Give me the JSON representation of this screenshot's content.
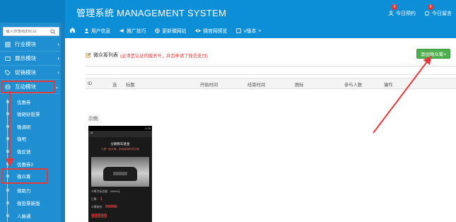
{
  "header": {
    "title": "管理系统 MANAGEMENT SYSTEM",
    "links": [
      {
        "label": "今日预约",
        "badge": "0",
        "icon": "user-icon"
      },
      {
        "label": "今日留言",
        "badge": "0",
        "icon": "message-icon"
      }
    ]
  },
  "sidebar": {
    "search_placeholder": "输入你想找的栏目",
    "sections": [
      {
        "label": "行业模块",
        "icon": "grid-icon"
      },
      {
        "label": "展示模块",
        "icon": "display-icon"
      },
      {
        "label": "促销模块",
        "icon": "tag-icon"
      },
      {
        "label": "互动模块",
        "icon": "chart-icon"
      }
    ],
    "sub_items": [
      "优惠券",
      "微砸砂投票",
      "微调研",
      "微吧",
      "微反馈",
      "优惠券2",
      "微众筹",
      "微助力",
      "微投票新版",
      "人脉通"
    ]
  },
  "navbar": {
    "items": [
      {
        "label": "用户信息",
        "icon": "user-icon"
      },
      {
        "label": "推广技巧",
        "icon": "megaphone-icon"
      },
      {
        "label": "更新微网站",
        "icon": "globe-icon"
      },
      {
        "label": "微官网预览",
        "icon": "eye-icon"
      },
      {
        "label": "V版本",
        "icon": "version-icon"
      }
    ],
    "more": "»"
  },
  "main": {
    "list_title": "微众筹列表",
    "list_note": "(必须是认证的服务号，并且申请了微信支付)",
    "add_button": "添加微众筹+",
    "table_headers": [
      "ID",
      "选",
      "标题",
      "开始时间",
      "结束时间",
      "图标",
      "参与人数",
      "操作"
    ],
    "example_label": "示例:"
  },
  "phone_preview": {
    "status": "9:25",
    "close": "×",
    "title": "分期购车基金",
    "subtitle": "凡是一起众筹，即送高端车型试驾",
    "rows": [
      {
        "text": "众筹目标金额：99999元",
        "highlight": ""
      },
      {
        "text": "已筹：",
        "highlight": "1"
      },
      {
        "text": "众筹剩余：",
        "highlight": "99998"
      }
    ],
    "big_value": "99999"
  }
}
